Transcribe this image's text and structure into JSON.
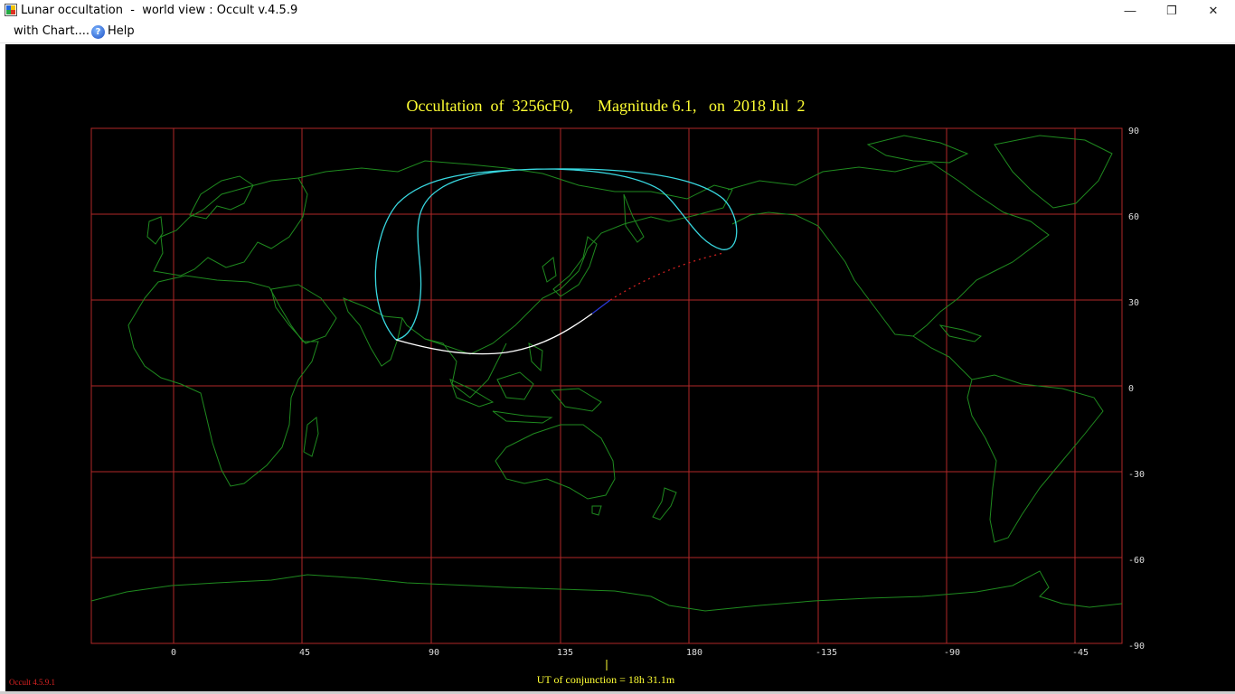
{
  "window": {
    "title": "Lunar occultation  -  world view : Occult v.4.5.9",
    "minimize_glyph": "—",
    "restore_glyph": "❐",
    "close_glyph": "✕"
  },
  "menu": {
    "items": [
      {
        "label": "with Chart...."
      },
      {
        "label": "Help",
        "icon": "help-icon"
      }
    ]
  },
  "map": {
    "title": "Occultation  of  3256cF0,      Magnitude 6.1,   on  2018 Jul  2",
    "lat_labels": [
      "90",
      "60",
      "30",
      "0",
      "-30",
      "-60",
      "-90"
    ],
    "lon_labels": [
      "0",
      "45",
      "90",
      "135",
      "180",
      "-135",
      "-90",
      "-45"
    ],
    "conjunction_label": "UT of conjunction = 18h 31.1m",
    "version_label": "Occult 4.5.9.1",
    "colors": {
      "background": "#000000",
      "grid": "#b02828",
      "coastline": "#1f8a1f",
      "limit_curve": "#38d8e0",
      "central_line_day": "#ffffff",
      "central_line_twilight": "#2a3ad8",
      "central_line_below_horizon": "#d02020",
      "text": "#ffff33"
    }
  }
}
